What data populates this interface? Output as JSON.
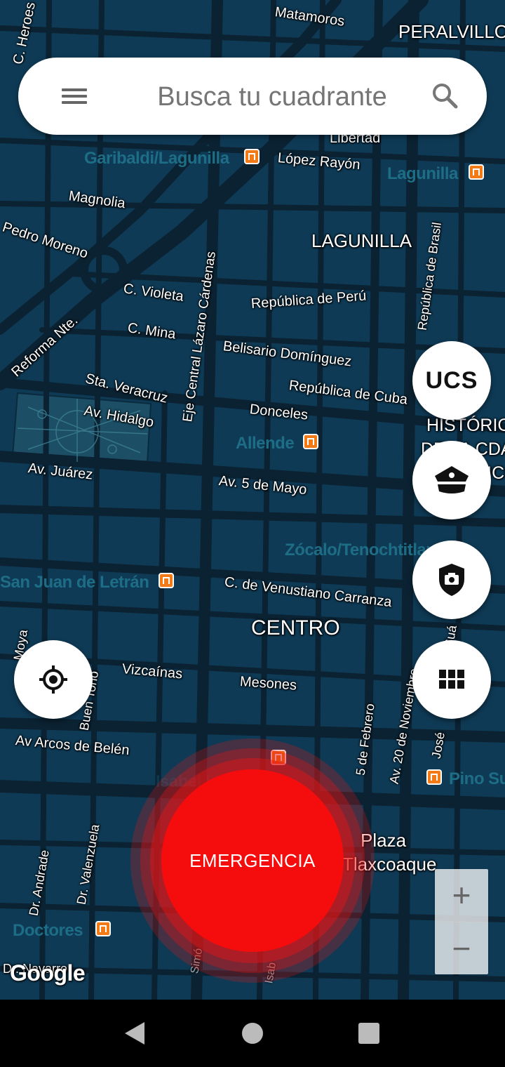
{
  "search": {
    "placeholder": "Busca tu cuadrante",
    "menu_icon": "hamburger-menu-icon",
    "search_icon": "magnifier-icon"
  },
  "map": {
    "areas": [
      "PERALVILLO",
      "LAGUNILLA",
      "CENTRO",
      "HISTÓRICO",
      "DE LA CDA",
      "MÉXICO",
      "Plaza",
      "Tlaxcoaque"
    ],
    "streets": [
      "C. Heroes",
      "Matamoros",
      "Libertad",
      "López Rayón",
      "Magnolia",
      "Pedro Moreno",
      "República de Brasil",
      "Eje Central Lázaro Cárdenas",
      "C. Violeta",
      "República de Perú",
      "C. Mina",
      "Reforma Nte.",
      "Belisario Domínguez",
      "República de Cuba",
      "Sta. Veracruz",
      "Av. Hidalgo",
      "Donceles",
      "Av. Juárez",
      "Av. 5 de Mayo",
      "C. de Venustiano Carranza",
      "Vizcaínas",
      "Mesones",
      "Av Arcos de Belén",
      "5 de Febrero",
      "Av. 20 de Noviembre",
      "Dr. Andrade",
      "Dr. Valenzuela",
      "Buen Tono",
      "Moya",
      "José",
      "Suá",
      "Simó",
      "Isab",
      "Dr. Navarro"
    ],
    "stations": [
      "Garibaldi/Lagunilla",
      "Lagunilla",
      "Allende",
      "Zócalo/Tenochtitlan",
      "San Juan de Letrán",
      "Isabel la Católica",
      "Pino Suárez",
      "Doctores"
    ],
    "attribution": "Google"
  },
  "fabs": {
    "ucs_label": "UCS",
    "police_icon": "police-cap-icon",
    "camera_icon": "shield-camera-icon",
    "grid_icon": "grid-icon",
    "location_icon": "my-location-icon"
  },
  "emergency": {
    "label": "EMERGENCIA",
    "color": "#f50d0d"
  },
  "zoom": {
    "in_label": "+",
    "out_label": "−"
  },
  "nav": {
    "back_icon": "back-triangle-icon",
    "home_icon": "home-circle-icon",
    "recents_icon": "recents-square-icon"
  },
  "colors": {
    "map_bg": "#0f3a55",
    "metro": "#f27b17",
    "station_text": "#1e6d86"
  }
}
